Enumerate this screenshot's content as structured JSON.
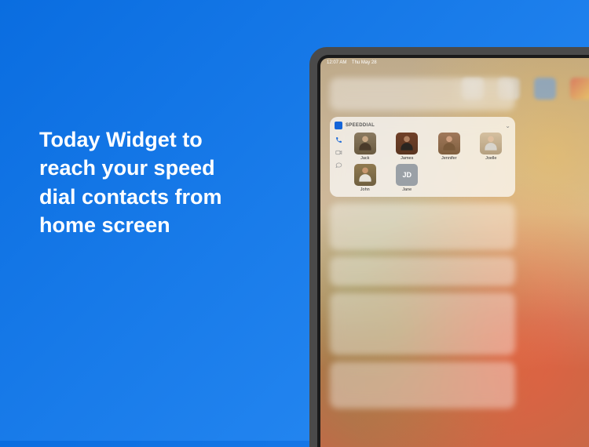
{
  "marketing": {
    "headline": "Today Widget to reach your speed dial contacts from home screen"
  },
  "statusbar": {
    "time": "12:07 AM",
    "date": "Thu May 28"
  },
  "widget": {
    "title": "SPEEDDIAL",
    "contacts": [
      {
        "name": "Jack",
        "initials": ""
      },
      {
        "name": "James",
        "initials": ""
      },
      {
        "name": "Jennifer",
        "initials": ""
      },
      {
        "name": "Joelle",
        "initials": ""
      },
      {
        "name": "John",
        "initials": ""
      },
      {
        "name": "Jane",
        "initials": "JD"
      }
    ]
  },
  "icons": {
    "phone": "phone-icon",
    "video": "video-icon",
    "message": "message-icon",
    "chevron": "chevron-down-icon"
  }
}
